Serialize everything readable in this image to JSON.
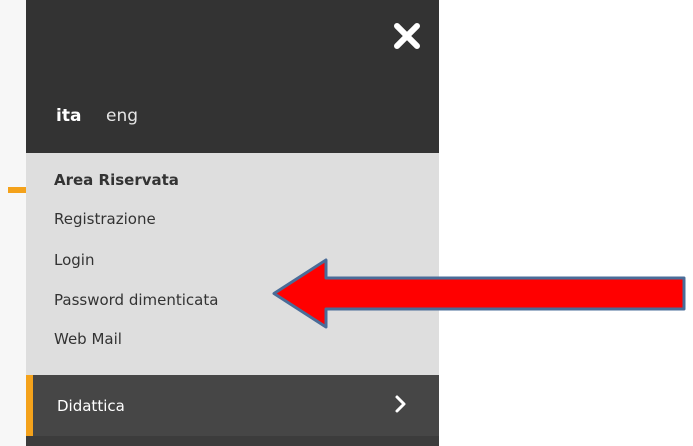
{
  "background": {
    "accent_color": "#f4a21b"
  },
  "menu": {
    "close_icon": "close-icon",
    "languages": {
      "ita": "ita",
      "eng": "eng"
    },
    "reserved_area": {
      "title": "Area Riservata",
      "links": [
        "Registrazione",
        "Login",
        "Password dimenticata",
        "Web Mail"
      ]
    },
    "didattica": {
      "label": "Didattica",
      "icon": "chevron-right-icon"
    },
    "colors": {
      "top_bg": "#333333",
      "panel_bg": "#dedede",
      "bottom_bg": "#464646",
      "accent": "#f4a21b"
    }
  },
  "annotation": {
    "arrow_color": "#ff0000",
    "arrow_outline": "#4a6c98"
  }
}
